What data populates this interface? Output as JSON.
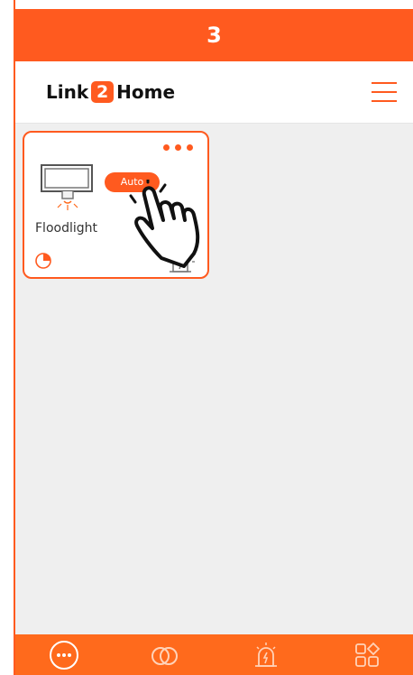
{
  "step": {
    "number": "3"
  },
  "header": {
    "logo_prefix": "Link",
    "logo_two": "2",
    "logo_suffix": "Home"
  },
  "device_card": {
    "name": "Floodlight",
    "badge": "Auto",
    "icons": {
      "menu": "more-dots-icon",
      "device": "floodlight-icon",
      "timer": "timer-icon",
      "alarm": "alarm-icon"
    }
  },
  "bottom_nav": {
    "items": [
      {
        "name": "devices",
        "icon": "devices-icon"
      },
      {
        "name": "links",
        "icon": "links-icon"
      },
      {
        "name": "alarm",
        "icon": "alarm-icon"
      },
      {
        "name": "scenes",
        "icon": "scenes-icon"
      }
    ]
  },
  "colors": {
    "primary": "#ff5a1f",
    "nav_background": "#ff6a1c",
    "content_background": "#efefef",
    "text_dark": "#333333"
  }
}
